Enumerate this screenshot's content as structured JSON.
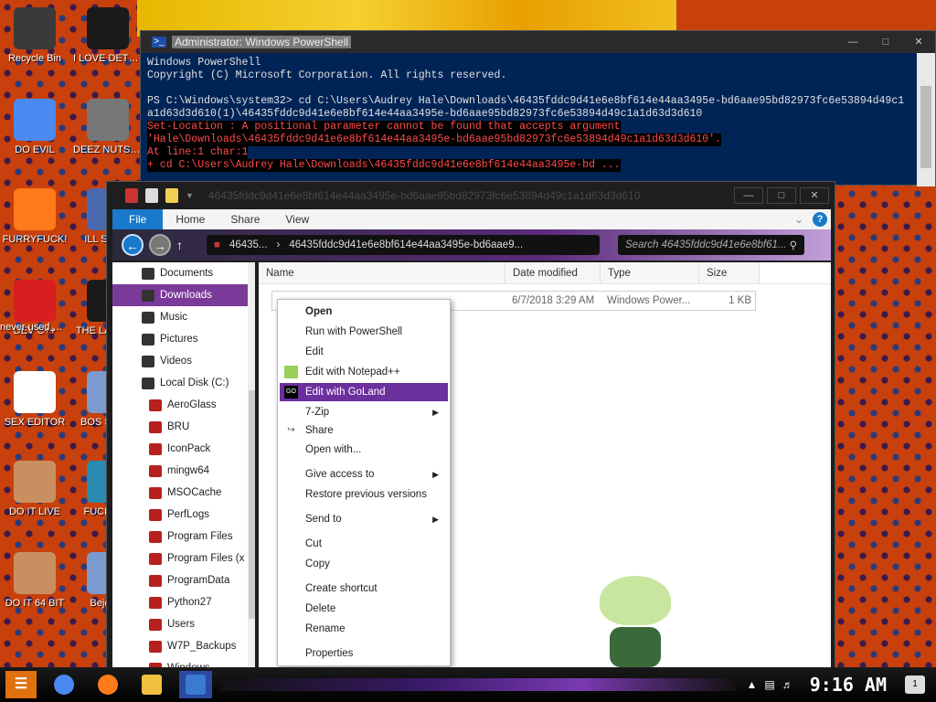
{
  "desktop": {
    "icons": [
      {
        "label": "Recycle Bin",
        "color": "#3a3a3a"
      },
      {
        "label": "I LOVE DETECTING...",
        "color": "#1a1a1a"
      },
      {
        "label": "DO EVIL",
        "color": "#4a8af0"
      },
      {
        "label": "DEEZ NUTS HAH GOTTI",
        "color": "#777777"
      },
      {
        "label": "FURRYFUCK!",
        "color": "#ff7a1a"
      },
      {
        "label": "ILL SE YO",
        "color": "#4a6ab0"
      },
      {
        "label": "DEV C++",
        "color": "#d81e1e"
      },
      {
        "label": "never used why is it ...",
        "color": "#d81e1e"
      },
      {
        "label": "THE LANGUA",
        "color": "#1a1a1a"
      },
      {
        "label": "SEX EDITOR",
        "color": "#ffffff"
      },
      {
        "label": "BOS SIMUL",
        "color": "#7a9ad0"
      },
      {
        "label": "DO IT LIVE",
        "color": "#c89060"
      },
      {
        "label": "FUCK ELV",
        "color": "#2a8ab0"
      },
      {
        "label": "DO IT 64 BIT",
        "color": "#c89060"
      },
      {
        "label": "Beje De",
        "color": "#7a9ad0"
      }
    ]
  },
  "powershell": {
    "title": "Administrator: Windows PowerShell",
    "lines": [
      {
        "text": "Windows PowerShell",
        "err": false
      },
      {
        "text": "Copyright (C) Microsoft Corporation. All rights reserved.",
        "err": false
      },
      {
        "text": "",
        "err": false
      },
      {
        "text": "PS C:\\Windows\\system32> cd C:\\Users\\Audrey Hale\\Downloads\\46435fddc9d41e6e8bf614e44aa3495e-bd6aae95bd82973fc6e53894d49c1",
        "err": false
      },
      {
        "text": "a1d63d3d610(1)\\46435fddc9d41e6e8bf614e44aa3495e-bd6aae95bd82973fc6e53894d49c1a1d63d3d610",
        "err": false
      },
      {
        "text": "Set-Location : A positional parameter cannot be found that accepts argument",
        "err": true
      },
      {
        "text": "'Hale\\Downloads\\46435fddc9d41e6e8bf614e44aa3495e-bd6aae95bd82973fc6e53894d49c1a1d63d3d610'.",
        "err": true
      },
      {
        "text": "At line:1 char:1",
        "err": true
      },
      {
        "text": "+ cd C:\\Users\\Audrey Hale\\Downloads\\46435fddc9d41e6e8bf614e44aa3495e-bd ...",
        "err": true
      }
    ]
  },
  "explorer": {
    "title": "46435fddc9d41e6e8bf614e44aa3495e-bd6aae95bd82973fc6e53894d49c1a1d63d3d610",
    "ribbon_tabs": [
      "File",
      "Home",
      "Share",
      "View"
    ],
    "address_parts": [
      "46435...",
      "46435fddc9d41e6e8bf614e44aa3495e-bd6aae9..."
    ],
    "search_placeholder": "Search 46435fddc9d41e6e8bf61...",
    "nav_items": [
      {
        "label": "Documents",
        "indent": 0,
        "selected": false
      },
      {
        "label": "Downloads",
        "indent": 0,
        "selected": true
      },
      {
        "label": "Music",
        "indent": 0,
        "selected": false
      },
      {
        "label": "Pictures",
        "indent": 0,
        "selected": false
      },
      {
        "label": "Videos",
        "indent": 0,
        "selected": false
      },
      {
        "label": "Local Disk (C:)",
        "indent": 0,
        "selected": false
      },
      {
        "label": "AeroGlass",
        "indent": 1,
        "selected": false
      },
      {
        "label": "BRU",
        "indent": 1,
        "selected": false
      },
      {
        "label": "IconPack",
        "indent": 1,
        "selected": false
      },
      {
        "label": "mingw64",
        "indent": 1,
        "selected": false
      },
      {
        "label": "MSOCache",
        "indent": 1,
        "selected": false
      },
      {
        "label": "PerfLogs",
        "indent": 1,
        "selected": false
      },
      {
        "label": "Program Files",
        "indent": 1,
        "selected": false
      },
      {
        "label": "Program Files (x",
        "indent": 1,
        "selected": false
      },
      {
        "label": "ProgramData",
        "indent": 1,
        "selected": false
      },
      {
        "label": "Python27",
        "indent": 1,
        "selected": false
      },
      {
        "label": "Users",
        "indent": 1,
        "selected": false
      },
      {
        "label": "W7P_Backups",
        "indent": 1,
        "selected": false
      },
      {
        "label": "Windows",
        "indent": 1,
        "selected": false
      }
    ],
    "columns": [
      "Name",
      "Date modified",
      "Type",
      "Size"
    ],
    "file": {
      "name": ", ...",
      "date": "6/7/2018 3:29 AM",
      "type": "Windows Power...",
      "size": "1 KB"
    }
  },
  "context_menu": {
    "items": [
      {
        "label": "Open",
        "bold": true,
        "highlight": false,
        "submenu": false,
        "icon": ""
      },
      {
        "label": "Run with PowerShell",
        "bold": false,
        "highlight": false,
        "submenu": false,
        "icon": ""
      },
      {
        "label": "Edit",
        "bold": false,
        "highlight": false,
        "submenu": false,
        "icon": ""
      },
      {
        "label": "Edit with Notepad++",
        "bold": false,
        "highlight": false,
        "submenu": false,
        "icon": "notepad-icon"
      },
      {
        "label": "Edit with GoLand",
        "bold": false,
        "highlight": true,
        "submenu": false,
        "icon": "goland-icon"
      },
      {
        "label": "7-Zip",
        "bold": false,
        "highlight": false,
        "submenu": true,
        "icon": ""
      },
      {
        "label": "Share",
        "bold": false,
        "highlight": false,
        "submenu": false,
        "icon": "share-icon"
      },
      {
        "label": "Open with...",
        "bold": false,
        "highlight": false,
        "submenu": false,
        "icon": ""
      },
      {
        "label": "Give access to",
        "bold": false,
        "highlight": false,
        "submenu": true,
        "icon": ""
      },
      {
        "label": "Restore previous versions",
        "bold": false,
        "highlight": false,
        "submenu": false,
        "icon": ""
      },
      {
        "label": "Send to",
        "bold": false,
        "highlight": false,
        "submenu": true,
        "icon": ""
      },
      {
        "label": "Cut",
        "bold": false,
        "highlight": false,
        "submenu": false,
        "icon": ""
      },
      {
        "label": "Copy",
        "bold": false,
        "highlight": false,
        "submenu": false,
        "icon": ""
      },
      {
        "label": "Create shortcut",
        "bold": false,
        "highlight": false,
        "submenu": false,
        "icon": ""
      },
      {
        "label": "Delete",
        "bold": false,
        "highlight": false,
        "submenu": false,
        "icon": ""
      },
      {
        "label": "Rename",
        "bold": false,
        "highlight": false,
        "submenu": false,
        "icon": ""
      },
      {
        "label": "Properties",
        "bold": false,
        "highlight": false,
        "submenu": false,
        "icon": ""
      }
    ]
  },
  "taskbar": {
    "clock": "9:16 AM",
    "notification_count": "1",
    "apps": [
      {
        "name": "chrome-icon",
        "color": "#4a8af0",
        "active": false
      },
      {
        "name": "firefox-icon",
        "color": "#ff7a1a",
        "active": false
      },
      {
        "name": "explorer-icon",
        "color": "#f0c040",
        "active": false
      },
      {
        "name": "powershell-icon",
        "color": "#3a7ad0",
        "active": true
      }
    ]
  }
}
